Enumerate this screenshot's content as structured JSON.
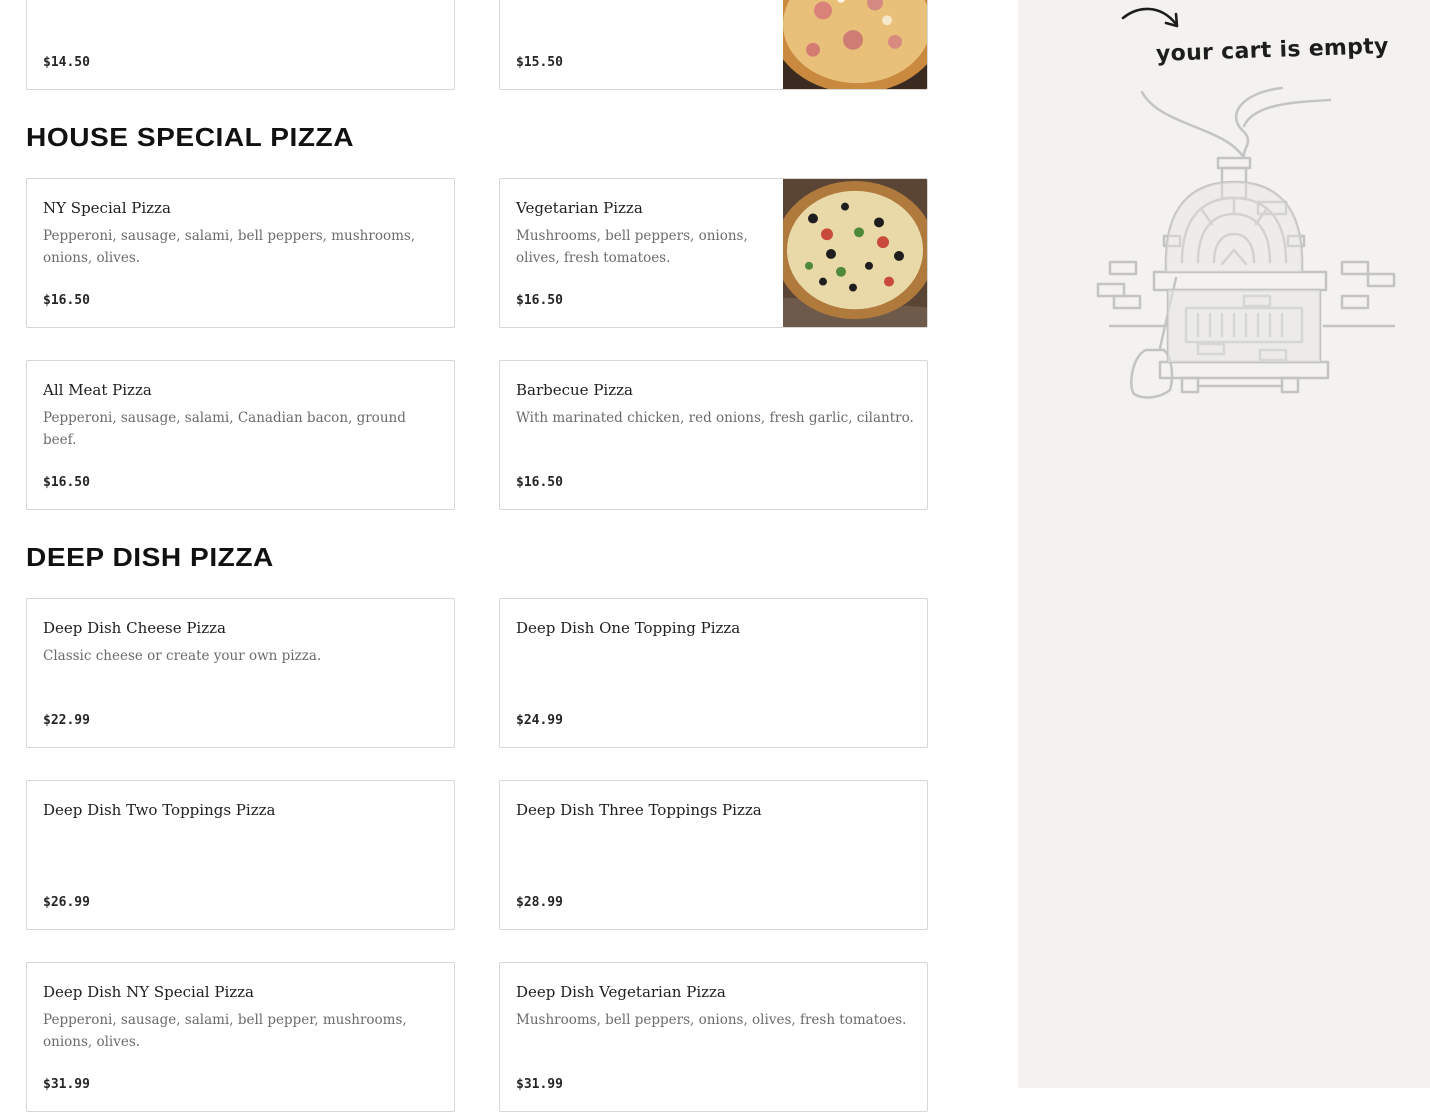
{
  "menu": {
    "partial_top_row": [
      {
        "price": "$14.50",
        "has_photo": false
      },
      {
        "price": "$15.50",
        "has_photo": true
      }
    ],
    "sections": [
      {
        "title": "HOUSE SPECIAL PIZZA",
        "items": [
          {
            "name": "NY Special Pizza",
            "description": "Pepperoni, sausage, salami, bell peppers, mushrooms, onions, olives.",
            "price": "$16.50",
            "has_photo": false
          },
          {
            "name": "Vegetarian Pizza",
            "description": "Mushrooms, bell peppers, onions, olives, fresh tomatoes.",
            "price": "$16.50",
            "has_photo": true
          },
          {
            "name": "All Meat Pizza",
            "description": "Pepperoni, sausage, salami, Canadian bacon, ground beef.",
            "price": "$16.50",
            "has_photo": false
          },
          {
            "name": "Barbecue Pizza",
            "description": "With marinated chicken, red onions, fresh garlic, cilantro.",
            "price": "$16.50",
            "has_photo": false
          }
        ]
      },
      {
        "title": "DEEP DISH PIZZA",
        "items": [
          {
            "name": "Deep Dish Cheese Pizza",
            "description": "Classic cheese or create your own pizza.",
            "price": "$22.99",
            "has_photo": false
          },
          {
            "name": "Deep Dish One Topping Pizza",
            "description": "",
            "price": "$24.99",
            "has_photo": false
          },
          {
            "name": "Deep Dish Two Toppings Pizza",
            "description": "",
            "price": "$26.99",
            "has_photo": false
          },
          {
            "name": "Deep Dish Three Toppings Pizza",
            "description": "",
            "price": "$28.99",
            "has_photo": false
          },
          {
            "name": "Deep Dish NY Special Pizza",
            "description": "Pepperoni, sausage, salami, bell pepper, mushrooms, onions, olives.",
            "price": "$31.99",
            "has_photo": false
          },
          {
            "name": "Deep Dish Vegetarian Pizza",
            "description": "Mushrooms, bell peppers, onions, olives, fresh tomatoes.",
            "price": "$31.99",
            "has_photo": false
          }
        ]
      }
    ]
  },
  "cart": {
    "empty_message": "your cart is empty",
    "arrow_icon": "curved-arrow-icon",
    "illustration": "pizza-oven-illustration"
  },
  "colors": {
    "page_background": "#ffffff",
    "cart_background": "#f3f2ef",
    "card_border": "#d6d6d6",
    "description_text": "#6b6b6b",
    "heading_text": "#111111"
  }
}
